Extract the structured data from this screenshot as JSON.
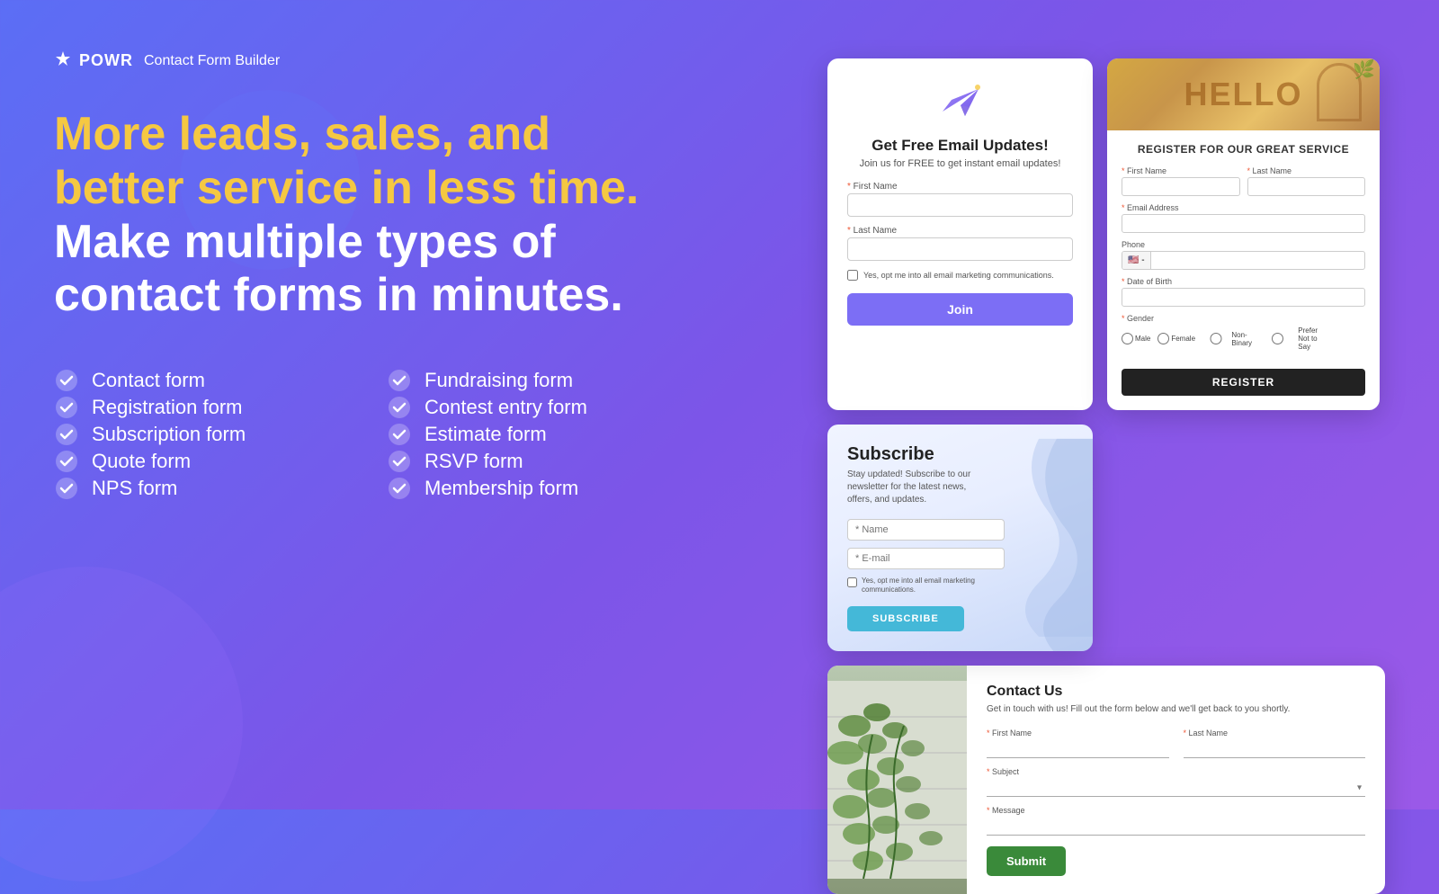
{
  "brand": {
    "icon": "⚡",
    "name": "POWR",
    "subtitle": "Contact Form Builder"
  },
  "headline": {
    "yellow_part": "More leads, sales, and better service in less time.",
    "white_part": " Make multiple types of contact forms in minutes."
  },
  "features": {
    "col1": [
      {
        "label": "Contact form"
      },
      {
        "label": "Registration form"
      },
      {
        "label": "Subscription form"
      },
      {
        "label": "Quote form"
      },
      {
        "label": "NPS form"
      }
    ],
    "col2": [
      {
        "label": "Fundraising form"
      },
      {
        "label": "Contest entry form"
      },
      {
        "label": "Estimate form"
      },
      {
        "label": "RSVP form"
      },
      {
        "label": "Membership form"
      }
    ]
  },
  "form_email": {
    "title": "Get Free Email Updates!",
    "subtitle": "Join us for FREE to get instant email updates!",
    "first_name_label": "* First Name",
    "last_name_label": "* Last Name",
    "checkbox_text": "Yes, opt me into all email marketing communications.",
    "btn_label": "Join"
  },
  "form_register": {
    "header_text": "HELLO",
    "title": "REGISTER FOR OUR GREAT SERVICE",
    "first_name_label": "* First Name",
    "last_name_label": "* Last Name",
    "email_label": "* Email Address",
    "phone_label": "Phone",
    "dob_label": "* Date of Birth",
    "gender_label": "* Gender",
    "gender_options": [
      "Male",
      "Female",
      "Non-Binary",
      "Prefer Not to Say"
    ],
    "btn_label": "REGISTER"
  },
  "form_subscribe": {
    "title": "Subscribe",
    "subtitle": "Stay updated! Subscribe to our newsletter for the latest news, offers, and updates.",
    "name_placeholder": "* Name",
    "email_placeholder": "* E-mail",
    "checkbox_text": "Yes, opt me into all email marketing communications.",
    "btn_label": "SUBSCRIBE"
  },
  "form_contact": {
    "title": "Contact Us",
    "subtitle": "Get in touch with us! Fill out the form below and we'll get back to you shortly.",
    "first_name_label": "* First Name",
    "last_name_label": "* Last Name",
    "subject_label": "* Subject",
    "message_label": "* Message",
    "btn_label": "Submit"
  }
}
